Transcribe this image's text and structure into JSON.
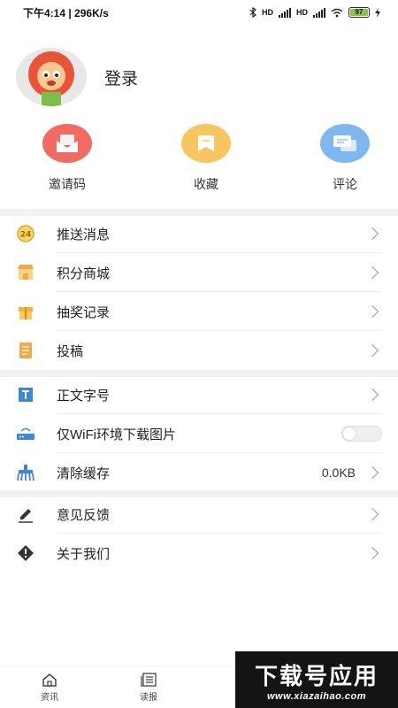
{
  "status_bar": {
    "time_speed": "下午4:14 | 296K/s",
    "hd1": "HD",
    "hd2": "HD",
    "battery": "97"
  },
  "profile": {
    "login_label": "登录"
  },
  "quick_actions": [
    {
      "label": "邀请码",
      "color": "#f26b63"
    },
    {
      "label": "收藏",
      "color": "#f8c661"
    },
    {
      "label": "评论",
      "color": "#7fb8f0"
    }
  ],
  "menu_group1": [
    {
      "label": "推送消息",
      "icon": "badge-24-icon"
    },
    {
      "label": "积分商城",
      "icon": "shop-icon"
    },
    {
      "label": "抽奖记录",
      "icon": "gift-icon"
    },
    {
      "label": "投稿",
      "icon": "document-icon"
    }
  ],
  "menu_group2": [
    {
      "label": "正文字号",
      "icon": "text-size-icon"
    },
    {
      "label": "仅WiFi环境下载图片",
      "icon": "router-icon",
      "toggle": false
    },
    {
      "label": "清除缓存",
      "icon": "broom-icon",
      "value": "0.0KB"
    }
  ],
  "menu_group3": [
    {
      "label": "意见反馈",
      "icon": "pen-icon"
    },
    {
      "label": "关于我们",
      "icon": "info-icon"
    }
  ],
  "tabbar": [
    {
      "label": "资讯",
      "icon": "home-icon"
    },
    {
      "label": "读报",
      "icon": "newspaper-icon"
    }
  ],
  "watermark": {
    "title": "下载号应用",
    "url": "www.xiazaihao.com"
  }
}
